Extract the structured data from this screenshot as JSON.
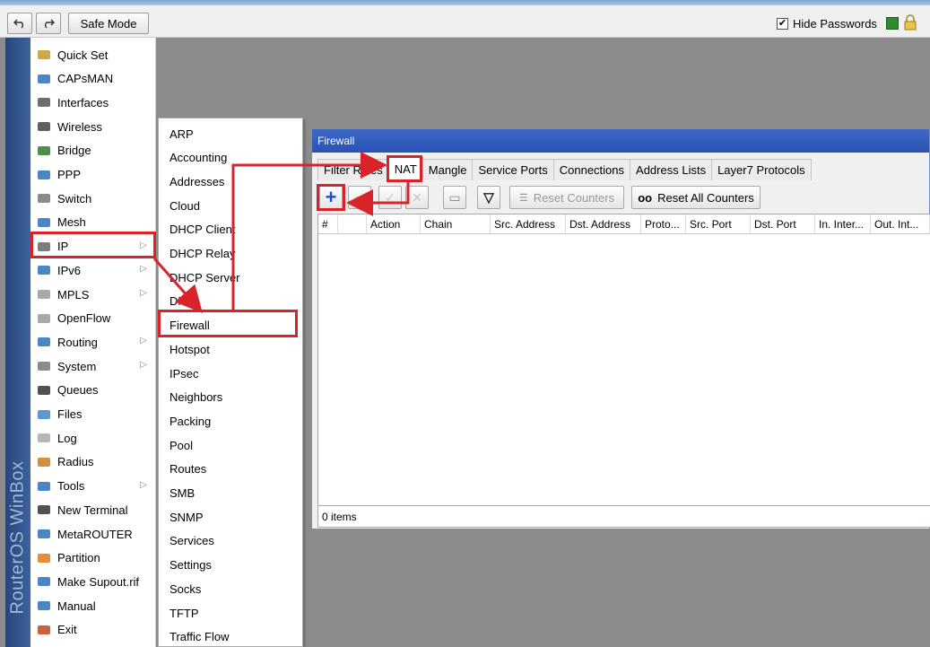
{
  "toolbar": {
    "undo_icon": "undo-icon",
    "redo_icon": "redo-icon",
    "safe_mode_label": "Safe Mode",
    "hide_passwords_label": "Hide Passwords",
    "hide_passwords_checked": "✔"
  },
  "brand": {
    "text": "RouterOS WinBox"
  },
  "menu": {
    "items": [
      {
        "label": "Quick Set",
        "icon": "quickset-icon",
        "has_sub": false
      },
      {
        "label": "CAPsMAN",
        "icon": "capsman-icon",
        "has_sub": false
      },
      {
        "label": "Interfaces",
        "icon": "interfaces-icon",
        "has_sub": false
      },
      {
        "label": "Wireless",
        "icon": "wireless-icon",
        "has_sub": false
      },
      {
        "label": "Bridge",
        "icon": "bridge-icon",
        "has_sub": false
      },
      {
        "label": "PPP",
        "icon": "ppp-icon",
        "has_sub": false
      },
      {
        "label": "Switch",
        "icon": "switch-icon",
        "has_sub": false
      },
      {
        "label": "Mesh",
        "icon": "mesh-icon",
        "has_sub": false
      },
      {
        "label": "IP",
        "icon": "ip-icon",
        "has_sub": true
      },
      {
        "label": "IPv6",
        "icon": "ipv6-icon",
        "has_sub": true
      },
      {
        "label": "MPLS",
        "icon": "mpls-icon",
        "has_sub": true
      },
      {
        "label": "OpenFlow",
        "icon": "openflow-icon",
        "has_sub": false
      },
      {
        "label": "Routing",
        "icon": "routing-icon",
        "has_sub": true
      },
      {
        "label": "System",
        "icon": "system-icon",
        "has_sub": true
      },
      {
        "label": "Queues",
        "icon": "queues-icon",
        "has_sub": false
      },
      {
        "label": "Files",
        "icon": "files-icon",
        "has_sub": false
      },
      {
        "label": "Log",
        "icon": "log-icon",
        "has_sub": false
      },
      {
        "label": "Radius",
        "icon": "radius-icon",
        "has_sub": false
      },
      {
        "label": "Tools",
        "icon": "tools-icon",
        "has_sub": true
      },
      {
        "label": "New Terminal",
        "icon": "terminal-icon",
        "has_sub": false
      },
      {
        "label": "MetaROUTER",
        "icon": "metarouter-icon",
        "has_sub": false
      },
      {
        "label": "Partition",
        "icon": "partition-icon",
        "has_sub": false
      },
      {
        "label": "Make Supout.rif",
        "icon": "supout-icon",
        "has_sub": false
      },
      {
        "label": "Manual",
        "icon": "manual-icon",
        "has_sub": false
      },
      {
        "label": "Exit",
        "icon": "exit-icon",
        "has_sub": false
      }
    ],
    "sub_arrow": "▷"
  },
  "ip_submenu": {
    "items": [
      "ARP",
      "Accounting",
      "Addresses",
      "Cloud",
      "DHCP Client",
      "DHCP Relay",
      "DHCP Server",
      "DNS",
      "Firewall",
      "Hotspot",
      "IPsec",
      "Neighbors",
      "Packing",
      "Pool",
      "Routes",
      "SMB",
      "SNMP",
      "Services",
      "Settings",
      "Socks",
      "TFTP",
      "Traffic Flow"
    ]
  },
  "firewall": {
    "title": "Firewall",
    "tabs": [
      "Filter Rules",
      "NAT",
      "Mangle",
      "Service Ports",
      "Connections",
      "Address Lists",
      "Layer7 Protocols"
    ],
    "active_tab": "NAT",
    "buttons": {
      "add_glyph": "+",
      "remove_glyph": "−",
      "enable_glyph": "✓",
      "disable_glyph": "✕",
      "comment_glyph": "▭",
      "filter_glyph": "▽",
      "reset_counters_label": "Reset Counters",
      "reset_all_prefix": "oo",
      "reset_all_label": "Reset All Counters"
    },
    "columns": [
      "#",
      "",
      "Action",
      "Chain",
      "Src. Address",
      "Dst. Address",
      "Proto...",
      "Src. Port",
      "Dst. Port",
      "In. Inter...",
      "Out. Int..."
    ],
    "status": "0 items"
  },
  "colors": {
    "highlight": "#d9232b",
    "title_bar": "#2a52b5",
    "brand_strip": "#3d62a0"
  }
}
